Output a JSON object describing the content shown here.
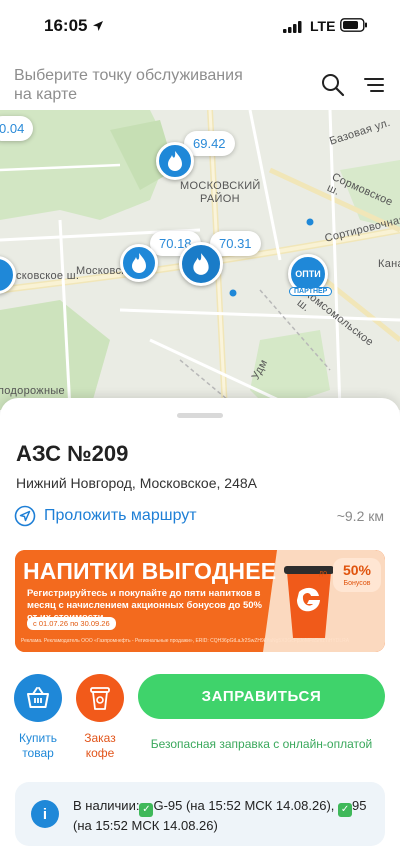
{
  "status_bar": {
    "time": "16:05",
    "network": "LTE"
  },
  "header": {
    "title": "Выберите точку обслуживания на карте"
  },
  "map": {
    "prices": [
      "0.04",
      "69.42",
      "70.18",
      "70.31"
    ],
    "district": [
      "МОСКОВСКИЙ",
      "РАЙОН"
    ],
    "streets": [
      "Московское ш.",
      "Московское ш.",
      "Сормовское ш.",
      "Комсомольское ш.",
      "Кана",
      "Удм",
      "Базовая ул.",
      "Сортировочная",
      "подорожные"
    ],
    "partner_badge": {
      "logo_text": "ОПТИ",
      "label": "ПАРТНЕР"
    }
  },
  "station": {
    "title": "АЗС №209",
    "address": "Нижний Новгород, Московское, 248А",
    "route_label": "Проложить маршрут",
    "distance": "~9.2 км"
  },
  "promo": {
    "title": "НАПИТКИ ВЫГОДНЕЕ",
    "subtitle": "Регистрируйтесь и покупайте до пяти напитков в месяц с начислением акционных бонусов до 50% от их стоимости",
    "dates": "с 01.07.26 по 30.09.26",
    "badge_percent": "50%",
    "badge_prefix": "до",
    "badge_caption": "Бонусов",
    "legal": "Реклама. Рекламодатель ООО «Газпромнефть - Региональные продажи», ERID: CQH36pGtLaJr2SwZH9kYaNg5X3GcFpJoMFaSmzTiHYDLRA"
  },
  "actions": {
    "buy_label": "Купить товар",
    "coffee_label": "Заказ кофе",
    "fill_label": "ЗАПРАВИТЬСЯ",
    "fill_caption": "Безопасная заправка с онлайн-оплатой"
  },
  "availability": {
    "prefix": "В наличии:",
    "item1": "G-95 (на 15:52 МСК 14.08.26),",
    "item2": "95 (на 15:52 МСК 14.08.26)"
  },
  "colors": {
    "accent": "#1F88D8",
    "fill_button": "#3FD36B",
    "promo": "#F36A1E",
    "coffee": "#F25A1A"
  }
}
